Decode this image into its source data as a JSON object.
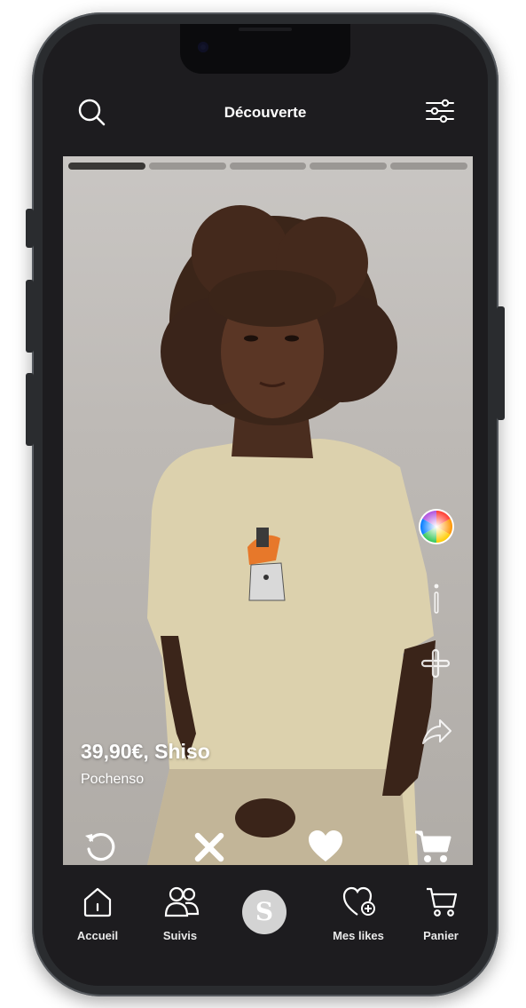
{
  "header": {
    "title": "Découverte"
  },
  "icons": {
    "search": "search-icon",
    "filters": "filter-sliders-icon",
    "color": "color-wheel-icon",
    "info": "info-icon",
    "add": "plus-icon",
    "share": "share-arrow-icon",
    "undo": "undo-icon",
    "dislike": "close-icon",
    "like": "heart-icon",
    "cart": "cart-icon"
  },
  "story_progress": {
    "segments": 5,
    "active_index": 0
  },
  "product": {
    "price_name": "39,90€, Shiso",
    "brand": "Pochenso"
  },
  "tabbar": {
    "items": [
      {
        "label": "Accueil",
        "icon": "home-icon"
      },
      {
        "label": "Suivis",
        "icon": "users-icon"
      },
      {
        "label": "S",
        "icon": "logo-icon"
      },
      {
        "label": "Mes likes",
        "icon": "heart-plus-icon"
      },
      {
        "label": "Panier",
        "icon": "cart-icon"
      }
    ]
  },
  "colors": {
    "screen_bg": "#1d1c1f",
    "accent_white": "#ffffff",
    "progress_active": "#3a3836",
    "progress_inactive": "#9a9794",
    "logo_bg": "#d3d3d3"
  }
}
